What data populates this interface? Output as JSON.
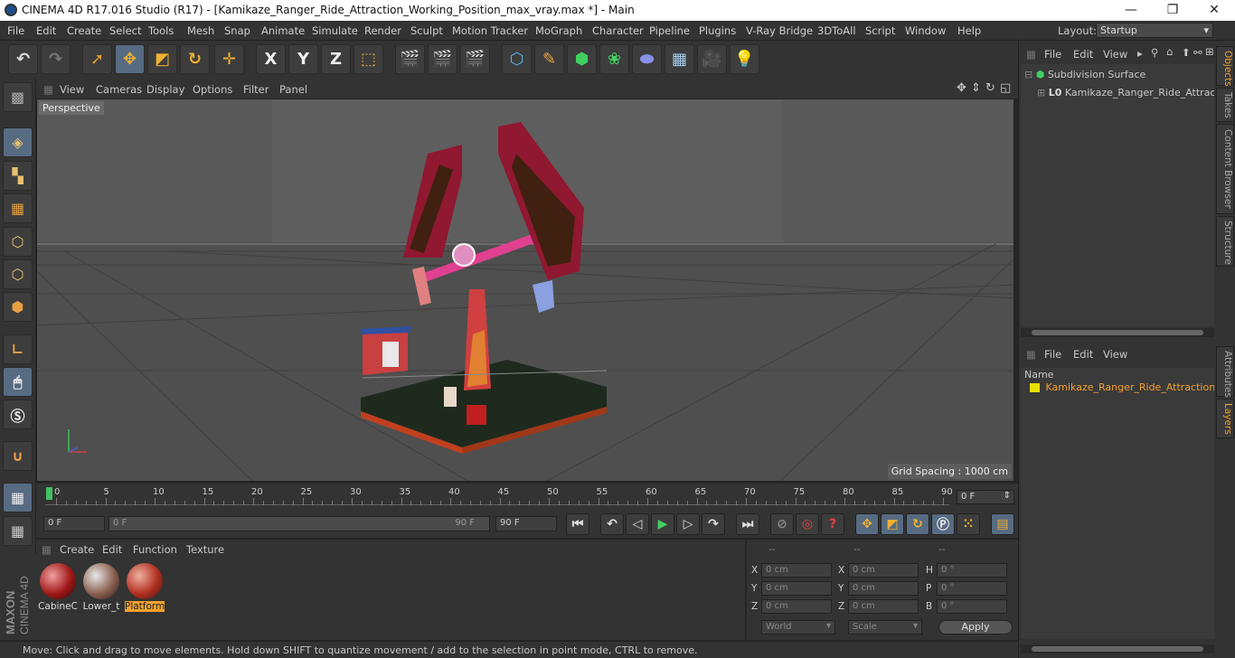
{
  "window": {
    "title": "CINEMA 4D R17.016 Studio (R17) - [Kamikaze_Ranger_Ride_Attraction_Working_Position_max_vray.max *] - Main"
  },
  "menu": [
    "File",
    "Edit",
    "Create",
    "Select",
    "Tools",
    "Mesh",
    "Snap",
    "Animate",
    "Simulate",
    "Render",
    "Sculpt",
    "Motion Tracker",
    "MoGraph",
    "Character",
    "Pipeline",
    "Plugins",
    "V-Ray Bridge",
    "3DToAll",
    "Script",
    "Window",
    "Help"
  ],
  "layout": {
    "label": "Layout:",
    "value": "Startup"
  },
  "toolbar": {
    "x": "X",
    "y": "Y",
    "z": "Z"
  },
  "viewport": {
    "menu": [
      "View",
      "Cameras",
      "Display",
      "Options",
      "Filter",
      "Panel"
    ],
    "label": "Perspective",
    "grid_spacing": "Grid Spacing : 1000 cm"
  },
  "timeline": {
    "ticks": [
      "0",
      "5",
      "10",
      "15",
      "20",
      "25",
      "30",
      "35",
      "40",
      "45",
      "50",
      "55",
      "60",
      "65",
      "70",
      "75",
      "80",
      "85",
      "90"
    ],
    "current_frame": "0 F",
    "start_field": "0 F",
    "range_start": "0 F",
    "range_end": "90 F",
    "end_field": "90 F"
  },
  "materials": {
    "menu": [
      "Create",
      "Edit",
      "Function",
      "Texture"
    ],
    "items": [
      {
        "name": "CabineC",
        "selected": false
      },
      {
        "name": "Lower_t",
        "selected": false
      },
      {
        "name": "Platform",
        "selected": true
      }
    ]
  },
  "coords": {
    "headers": [
      "--",
      "--",
      "--"
    ],
    "rows": [
      {
        "a": "X",
        "av": "0 cm",
        "b": "X",
        "bv": "0 cm",
        "c": "H",
        "cv": "0 °"
      },
      {
        "a": "Y",
        "av": "0 cm",
        "b": "Y",
        "bv": "0 cm",
        "c": "P",
        "cv": "0 °"
      },
      {
        "a": "Z",
        "av": "0 cm",
        "b": "Z",
        "bv": "0 cm",
        "c": "B",
        "cv": "0 °"
      }
    ],
    "mode1": "World",
    "mode2": "Scale",
    "apply": "Apply"
  },
  "status": "Move: Click and drag to move elements. Hold down SHIFT to quantize movement / add to the selection in point mode, CTRL to remove.",
  "objects": {
    "menu": [
      "File",
      "Edit",
      "View"
    ],
    "tree": [
      {
        "name": "Subdivision Surface"
      },
      {
        "name": "Kamikaze_Ranger_Ride_Attraction"
      }
    ]
  },
  "layers": {
    "menu": [
      "File",
      "Edit",
      "View"
    ],
    "header": "Name",
    "items": [
      "Kamikaze_Ranger_Ride_Attraction"
    ]
  },
  "side_tabs_top": [
    "Objects",
    "Takes",
    "Content Browser",
    "Structure"
  ],
  "side_tabs_bottom": [
    "Attributes",
    "Layers"
  ],
  "branding": {
    "line1": "MAXON",
    "line2": "CINEMA 4D"
  },
  "colors": {
    "accent": "#f0a030",
    "panel": "#333333",
    "viewport": "#5a5a5a",
    "highlight": "#576b82"
  }
}
